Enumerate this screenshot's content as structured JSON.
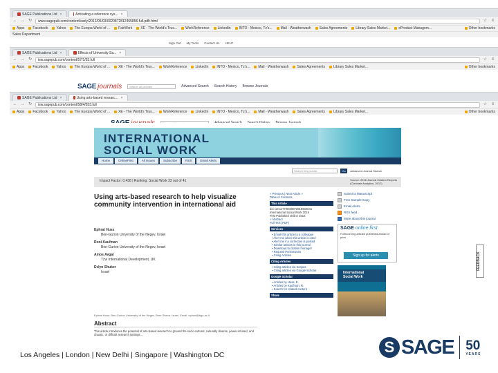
{
  "browser1": {
    "tabs": [
      "SAGE Publications Ltd",
      "Activating a reference sys..."
    ],
    "url": "www.sagepub.com/content/early/2012/05/03/0020872812455856.full.pdf+html",
    "bookmarks": [
      "Apps",
      "Facebook",
      "Yahoo",
      "The Europa World of ...",
      "FairWork",
      "XE - The World's Trus...",
      "WorkReference",
      "LinkedIn",
      "INTO - Mexico, Tz's...",
      "Mail - Weatherwash",
      "Sales Agreements",
      "Library Sales Market...",
      "eProduct Managem..."
    ],
    "other_bookmarks": "Other bookmarks",
    "extra_row": "Sales Department"
  },
  "util_strip": [
    "Sign Out",
    "My Tools",
    "Contact Us",
    "HELP"
  ],
  "browser2": {
    "tabs": [
      "SAGE Publications Ltd",
      "Effects of University Sa..."
    ],
    "url": "isw.sagepub.com/content/57/1/53.full"
  },
  "sage_header": {
    "logo_sage": "SAGE",
    "logo_journals": "journals",
    "search_placeholder": "Search all journals",
    "links": [
      "Advanced Search",
      "Search History",
      "Browse Journals"
    ]
  },
  "browser3": {
    "tabs": [
      "SAGE Publications Ltd",
      "Using arts-based researc..."
    ],
    "url": "isw.sagepub.com/content/58/4/553.full"
  },
  "journal": {
    "logo_sage": "SAGE",
    "logo_journals": "journals",
    "search_placeholder": "Search all journals",
    "header_links": [
      "Advanced Search",
      "Search History",
      "Browse Journals"
    ],
    "banner_title_line1": "INTERNATIONAL",
    "banner_title_line2": "SOCIAL WORK",
    "nav_tabs": [
      "Home",
      "OnlineFirst",
      "All Issues",
      "Subscribe",
      "RSS",
      "Email Alerts"
    ],
    "search_box": "Search this journal",
    "search_go": "Go",
    "advanced_link": "Advanced Journal Search",
    "impact": "Impact Factor: 0.438 | Ranking: Social Work 33 out of 41",
    "source_line1": "Source: 2016 Journal Citation Reports",
    "source_line2": "(Clarivate Analytics, 2017)"
  },
  "article": {
    "title": "Using arts-based research to help visualize community intervention in international aid",
    "authors": [
      {
        "name": "Ephrat Huss",
        "aff": "Ben-Gurion University of the Negev, Israel"
      },
      {
        "name": "Roni Kaufman",
        "aff": "Ben-Gurion University of the Negev, Israel"
      },
      {
        "name": "Amos Avgar",
        "aff": "Tzvi International Development, UK"
      },
      {
        "name": "Evlyn Shuker",
        "aff": "Israel"
      }
    ],
    "fine_print": "Ephrat Huss, Ben-Gurion University of the Negev, Beer Sheva, Israel. Email: ephrat@bgu.ac.il",
    "abstract_heading": "Abstract",
    "abstract_text": "This article introduces the potential of arts-based research to ground the socio-cultural, culturally diverse, power-infused, and chaotic, or difficult research settings..."
  },
  "midcol": {
    "prev": "« Previous | Next Article »",
    "toc": "Table of Contents",
    "this_article": "This Article",
    "doi": "doi: 10.1177/0020872816632641",
    "pub": "International Social Work 2016",
    "ahead": "First Published Online 2016",
    "abstract_link": "» Abstract",
    "full_text": "Full Text (PDF)",
    "services": "Services",
    "services_items": [
      "Email this article to a colleague",
      "Alert me when this article is cited",
      "Alert me if a correction is posted",
      "Similar articles in this journal",
      "Download to citation manager",
      "Request Permissions",
      "Citing Articles"
    ],
    "citing": "Citing Articles",
    "citing_items": [
      "Citing articles via Scopus",
      "Citing articles via Google Scholar"
    ],
    "google": "Google Scholar",
    "google_items": [
      "Articles by Huss, E.",
      "Articles by Kaufman, R.",
      "Search for related content"
    ],
    "share": "Share"
  },
  "rightcol": {
    "items": [
      "Submit a Manuscript",
      "Free Sample Copy",
      "Email Alerts",
      "RSS feed"
    ],
    "more": "More about this journal",
    "online_first_title": "online first",
    "online_first_sage": "SAGE",
    "online_first_desc": "Forthcoming articles published ahead of print",
    "signup": "Sign up for alerts",
    "cover_title_1": "International",
    "cover_title_2": "Social Work"
  },
  "feedback": "FEEDBACK",
  "footer": {
    "cities": "Los Angeles | London | New Delhi | Singapore | Washington DC",
    "logo_s": "S",
    "logo_word": "SAGE",
    "fifty": "50",
    "years": "YEARS"
  }
}
